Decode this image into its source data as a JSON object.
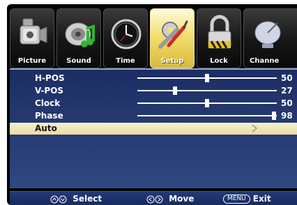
{
  "tabs": [
    {
      "label": "Picture",
      "icon": "camcorder-icon"
    },
    {
      "label": "Sound",
      "icon": "speaker-note-icon"
    },
    {
      "label": "Time",
      "icon": "clock-icon"
    },
    {
      "label": "Setup",
      "icon": "tools-icon",
      "active": true
    },
    {
      "label": "Lock",
      "icon": "padlock-icon"
    },
    {
      "label": "Channe",
      "icon": "satellite-dish-icon"
    }
  ],
  "settings": [
    {
      "name": "H-POS",
      "value": "50",
      "level": 0.5
    },
    {
      "name": "V-POS",
      "value": "27",
      "level": 0.27
    },
    {
      "name": "Clock",
      "value": "50",
      "level": 0.5
    },
    {
      "name": "Phase",
      "value": "98",
      "level": 0.98
    }
  ],
  "auto": {
    "name": "Auto"
  },
  "footer": {
    "select_label": "Select",
    "move_label": "Move",
    "menu_key": "MENU",
    "exit_label": "Exit"
  },
  "colors": {
    "panel": "#25396f",
    "highlight": "#f3e8b7",
    "active_tab": "#f0dc6a"
  }
}
